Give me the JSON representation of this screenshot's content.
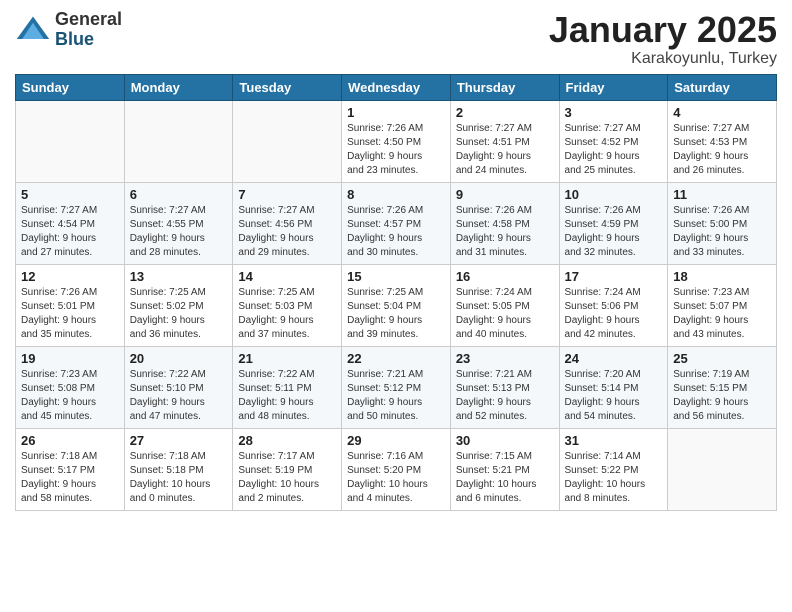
{
  "logo": {
    "general": "General",
    "blue": "Blue"
  },
  "title": "January 2025",
  "location": "Karakoyunlu, Turkey",
  "days_header": [
    "Sunday",
    "Monday",
    "Tuesday",
    "Wednesday",
    "Thursday",
    "Friday",
    "Saturday"
  ],
  "weeks": [
    [
      {
        "day": "",
        "info": ""
      },
      {
        "day": "",
        "info": ""
      },
      {
        "day": "",
        "info": ""
      },
      {
        "day": "1",
        "info": "Sunrise: 7:26 AM\nSunset: 4:50 PM\nDaylight: 9 hours\nand 23 minutes."
      },
      {
        "day": "2",
        "info": "Sunrise: 7:27 AM\nSunset: 4:51 PM\nDaylight: 9 hours\nand 24 minutes."
      },
      {
        "day": "3",
        "info": "Sunrise: 7:27 AM\nSunset: 4:52 PM\nDaylight: 9 hours\nand 25 minutes."
      },
      {
        "day": "4",
        "info": "Sunrise: 7:27 AM\nSunset: 4:53 PM\nDaylight: 9 hours\nand 26 minutes."
      }
    ],
    [
      {
        "day": "5",
        "info": "Sunrise: 7:27 AM\nSunset: 4:54 PM\nDaylight: 9 hours\nand 27 minutes."
      },
      {
        "day": "6",
        "info": "Sunrise: 7:27 AM\nSunset: 4:55 PM\nDaylight: 9 hours\nand 28 minutes."
      },
      {
        "day": "7",
        "info": "Sunrise: 7:27 AM\nSunset: 4:56 PM\nDaylight: 9 hours\nand 29 minutes."
      },
      {
        "day": "8",
        "info": "Sunrise: 7:26 AM\nSunset: 4:57 PM\nDaylight: 9 hours\nand 30 minutes."
      },
      {
        "day": "9",
        "info": "Sunrise: 7:26 AM\nSunset: 4:58 PM\nDaylight: 9 hours\nand 31 minutes."
      },
      {
        "day": "10",
        "info": "Sunrise: 7:26 AM\nSunset: 4:59 PM\nDaylight: 9 hours\nand 32 minutes."
      },
      {
        "day": "11",
        "info": "Sunrise: 7:26 AM\nSunset: 5:00 PM\nDaylight: 9 hours\nand 33 minutes."
      }
    ],
    [
      {
        "day": "12",
        "info": "Sunrise: 7:26 AM\nSunset: 5:01 PM\nDaylight: 9 hours\nand 35 minutes."
      },
      {
        "day": "13",
        "info": "Sunrise: 7:25 AM\nSunset: 5:02 PM\nDaylight: 9 hours\nand 36 minutes."
      },
      {
        "day": "14",
        "info": "Sunrise: 7:25 AM\nSunset: 5:03 PM\nDaylight: 9 hours\nand 37 minutes."
      },
      {
        "day": "15",
        "info": "Sunrise: 7:25 AM\nSunset: 5:04 PM\nDaylight: 9 hours\nand 39 minutes."
      },
      {
        "day": "16",
        "info": "Sunrise: 7:24 AM\nSunset: 5:05 PM\nDaylight: 9 hours\nand 40 minutes."
      },
      {
        "day": "17",
        "info": "Sunrise: 7:24 AM\nSunset: 5:06 PM\nDaylight: 9 hours\nand 42 minutes."
      },
      {
        "day": "18",
        "info": "Sunrise: 7:23 AM\nSunset: 5:07 PM\nDaylight: 9 hours\nand 43 minutes."
      }
    ],
    [
      {
        "day": "19",
        "info": "Sunrise: 7:23 AM\nSunset: 5:08 PM\nDaylight: 9 hours\nand 45 minutes."
      },
      {
        "day": "20",
        "info": "Sunrise: 7:22 AM\nSunset: 5:10 PM\nDaylight: 9 hours\nand 47 minutes."
      },
      {
        "day": "21",
        "info": "Sunrise: 7:22 AM\nSunset: 5:11 PM\nDaylight: 9 hours\nand 48 minutes."
      },
      {
        "day": "22",
        "info": "Sunrise: 7:21 AM\nSunset: 5:12 PM\nDaylight: 9 hours\nand 50 minutes."
      },
      {
        "day": "23",
        "info": "Sunrise: 7:21 AM\nSunset: 5:13 PM\nDaylight: 9 hours\nand 52 minutes."
      },
      {
        "day": "24",
        "info": "Sunrise: 7:20 AM\nSunset: 5:14 PM\nDaylight: 9 hours\nand 54 minutes."
      },
      {
        "day": "25",
        "info": "Sunrise: 7:19 AM\nSunset: 5:15 PM\nDaylight: 9 hours\nand 56 minutes."
      }
    ],
    [
      {
        "day": "26",
        "info": "Sunrise: 7:18 AM\nSunset: 5:17 PM\nDaylight: 9 hours\nand 58 minutes."
      },
      {
        "day": "27",
        "info": "Sunrise: 7:18 AM\nSunset: 5:18 PM\nDaylight: 10 hours\nand 0 minutes."
      },
      {
        "day": "28",
        "info": "Sunrise: 7:17 AM\nSunset: 5:19 PM\nDaylight: 10 hours\nand 2 minutes."
      },
      {
        "day": "29",
        "info": "Sunrise: 7:16 AM\nSunset: 5:20 PM\nDaylight: 10 hours\nand 4 minutes."
      },
      {
        "day": "30",
        "info": "Sunrise: 7:15 AM\nSunset: 5:21 PM\nDaylight: 10 hours\nand 6 minutes."
      },
      {
        "day": "31",
        "info": "Sunrise: 7:14 AM\nSunset: 5:22 PM\nDaylight: 10 hours\nand 8 minutes."
      },
      {
        "day": "",
        "info": ""
      }
    ]
  ]
}
